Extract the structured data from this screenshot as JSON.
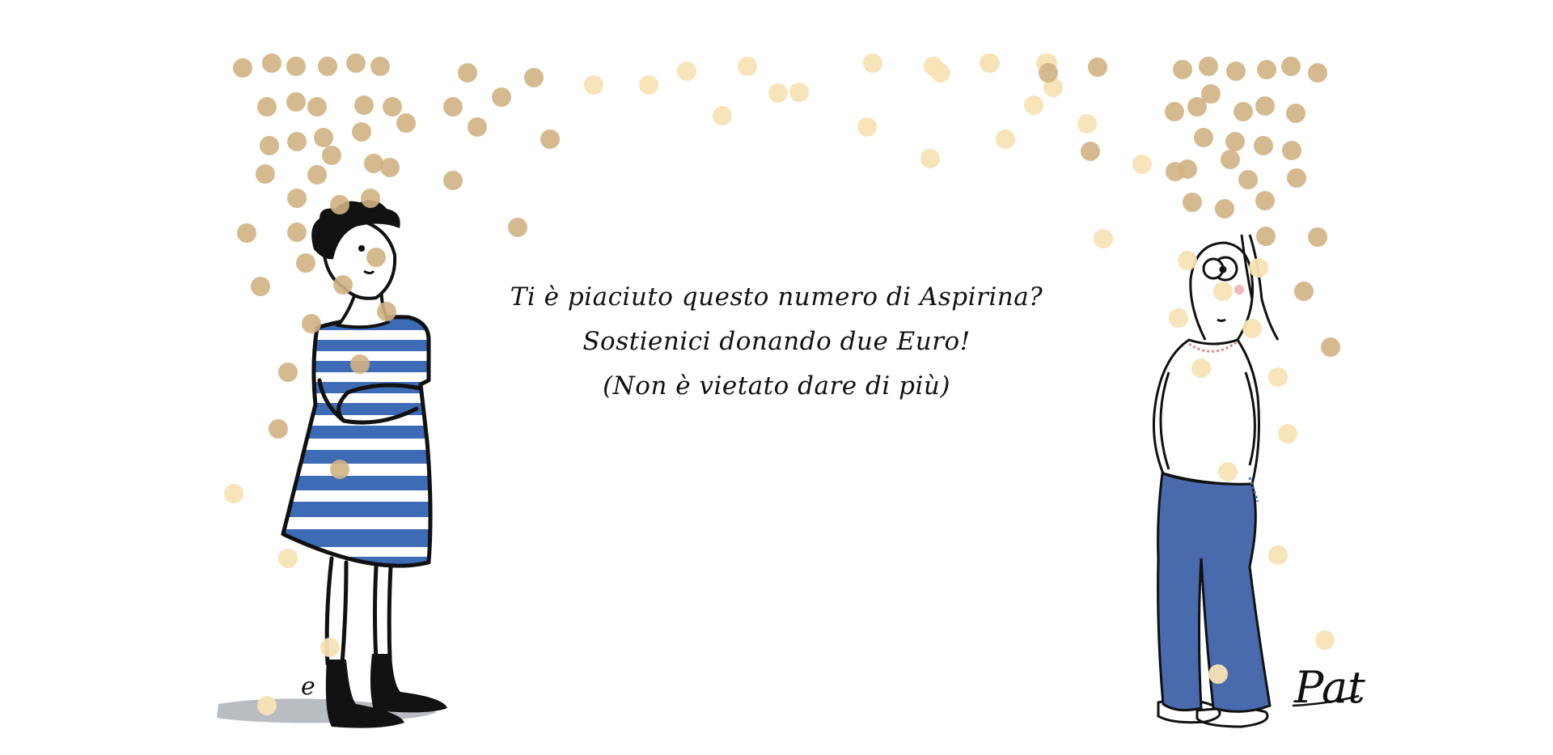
{
  "message": {
    "line1": "Ti è piaciuto questo numero di Aspirina?",
    "line2": "Sostienici donando due Euro!",
    "line3": "(Non è vietato dare di più)"
  },
  "signatures": {
    "left": "e",
    "right": "Pat"
  },
  "colors": {
    "background": "#ffffff",
    "ink": "#111111",
    "stripe_blue": "#3d6bb5",
    "jeans_blue": "#4a6aae",
    "coin_dark": "#d2b383",
    "coin_light": "#f7e3b5",
    "shadow": "#b9bcc0"
  },
  "decorations": {
    "falling_coins": "gold-coin-dots"
  }
}
